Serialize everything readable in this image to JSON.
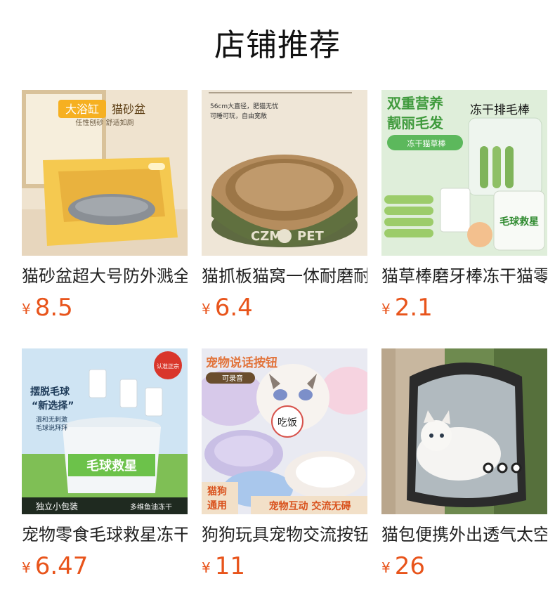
{
  "page": {
    "title": "店铺推荐"
  },
  "colors": {
    "price": "#e8541b",
    "text": "#222222"
  },
  "products": [
    {
      "name": "猫砂盆超大号防外溅全半封闭式",
      "currency": "¥",
      "price": "8.5",
      "image": {
        "icon": "cat-litter-box-image",
        "texts": [
          "大浴缸",
          "猫砂盆",
          "任性刨砂 舒适如厕"
        ]
      }
    },
    {
      "name": "猫抓板猫窝一体耐磨耐抓",
      "currency": "¥",
      "price": "6.4",
      "image": {
        "icon": "cat-scratcher-bed-image",
        "texts": [
          "56cm大直径，肥猫无忧",
          "可睡可玩，自由宽敞",
          "CZM",
          "PET"
        ]
      }
    },
    {
      "name": "猫草棒磨牙棒冻干猫零食",
      "currency": "¥",
      "price": "2.1",
      "image": {
        "icon": "cat-grass-sticks-image",
        "texts": [
          "双重营养",
          "靓丽毛发",
          "冻干排毛棒",
          "冻干猫草棒",
          "毛球救星"
        ]
      }
    },
    {
      "name": "宠物零食毛球救星冻干猫草棒",
      "currency": "¥",
      "price": "6.47",
      "image": {
        "icon": "hairball-snack-bucket-image",
        "texts": [
          "摆脱毛球",
          "“新选择”",
          "温和无刺激",
          "毛球说拜拜",
          "认准正宗",
          "毛球救星",
          "独立小包装",
          "多维鱼油冻干"
        ]
      }
    },
    {
      "name": "狗狗玩具宠物交流按钮录音",
      "currency": "¥",
      "price": "11",
      "image": {
        "icon": "pet-talking-button-image",
        "texts": [
          "宠物说话按钮",
          "可录音",
          "吃饭",
          "猫狗",
          "通用",
          "宠物互动 交流无碍"
        ]
      }
    },
    {
      "name": "猫包便携外出透气太空舱",
      "currency": "¥",
      "price": "26",
      "image": {
        "icon": "cat-carrier-backpack-image",
        "texts": []
      }
    }
  ]
}
